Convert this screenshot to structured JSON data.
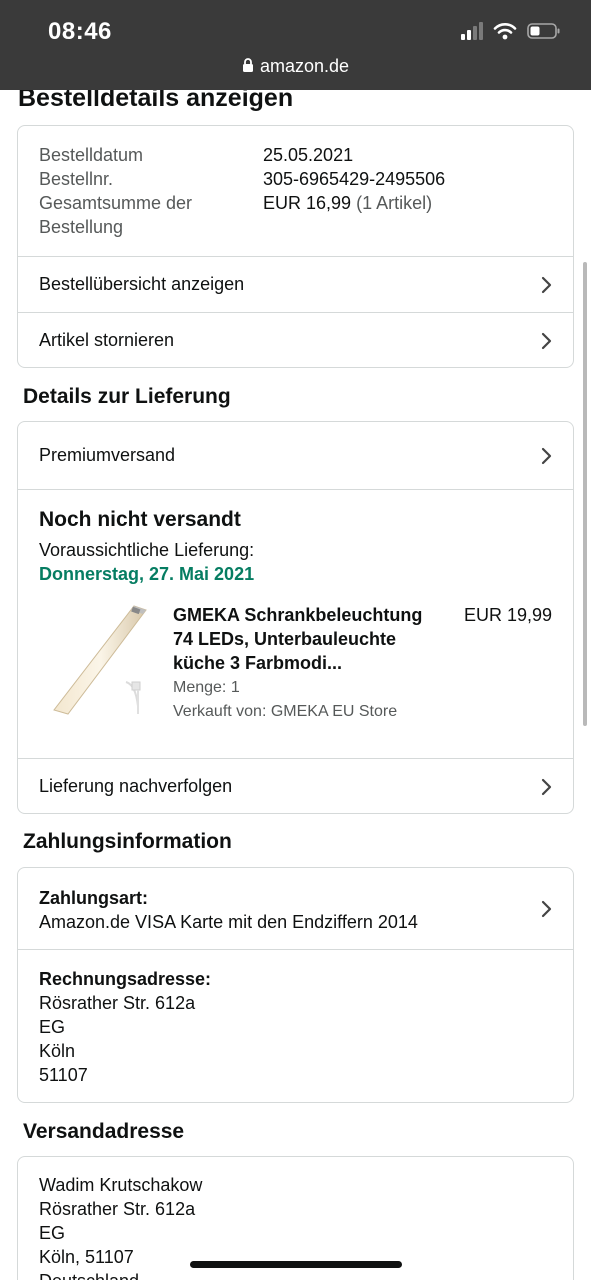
{
  "status_bar": {
    "time": "08:46",
    "url": "amazon.de"
  },
  "page_title": "Bestelldetails anzeigen",
  "order_summary": {
    "date_label": "Bestelldatum",
    "date_value": "25.05.2021",
    "number_label": "Bestellnr.",
    "number_value": "305-6965429-2495506",
    "total_label": "Gesamtsumme der Bestellung",
    "total_value": "EUR 16,99",
    "total_count": "(1 Artikel)",
    "links": [
      {
        "label": "Bestellübersicht anzeigen"
      },
      {
        "label": "Artikel stornieren"
      }
    ]
  },
  "delivery": {
    "section_title": "Details zur Lieferung",
    "shipping_method": "Premiumversand",
    "status_title": "Noch nicht versandt",
    "expected_label": "Voraussichtliche Lieferung:",
    "expected_date": "Donnerstag, 27. Mai 2021",
    "product": {
      "title_line1": "GMEKA Schrankbeleuchtung",
      "title_line2": "74 LEDs, Unterbauleuchte",
      "title_line3": "küche 3 Farbmodi...",
      "price": "EUR 19,99",
      "quantity": "Menge: 1",
      "seller": "Verkauft von: GMEKA EU Store"
    },
    "track_label": "Lieferung nachverfolgen"
  },
  "payment": {
    "section_title": "Zahlungsinformation",
    "method_label": "Zahlungsart:",
    "method_value": "Amazon.de VISA Karte mit den Endziffern 2014",
    "billing_label": "Rechnungsadresse:",
    "billing_lines": [
      "Rösrather Str. 612a",
      "EG",
      "Köln",
      "51107"
    ]
  },
  "shipping_address": {
    "section_title": "Versandadresse",
    "lines": [
      "Wadim Krutschakow",
      "Rösrather Str. 612a",
      "EG",
      "Köln, 51107",
      "Deutschland"
    ]
  },
  "colors": {
    "accent_green": "#067d62",
    "border": "#d5d9d9",
    "status_bar": "#3a3a3a"
  }
}
